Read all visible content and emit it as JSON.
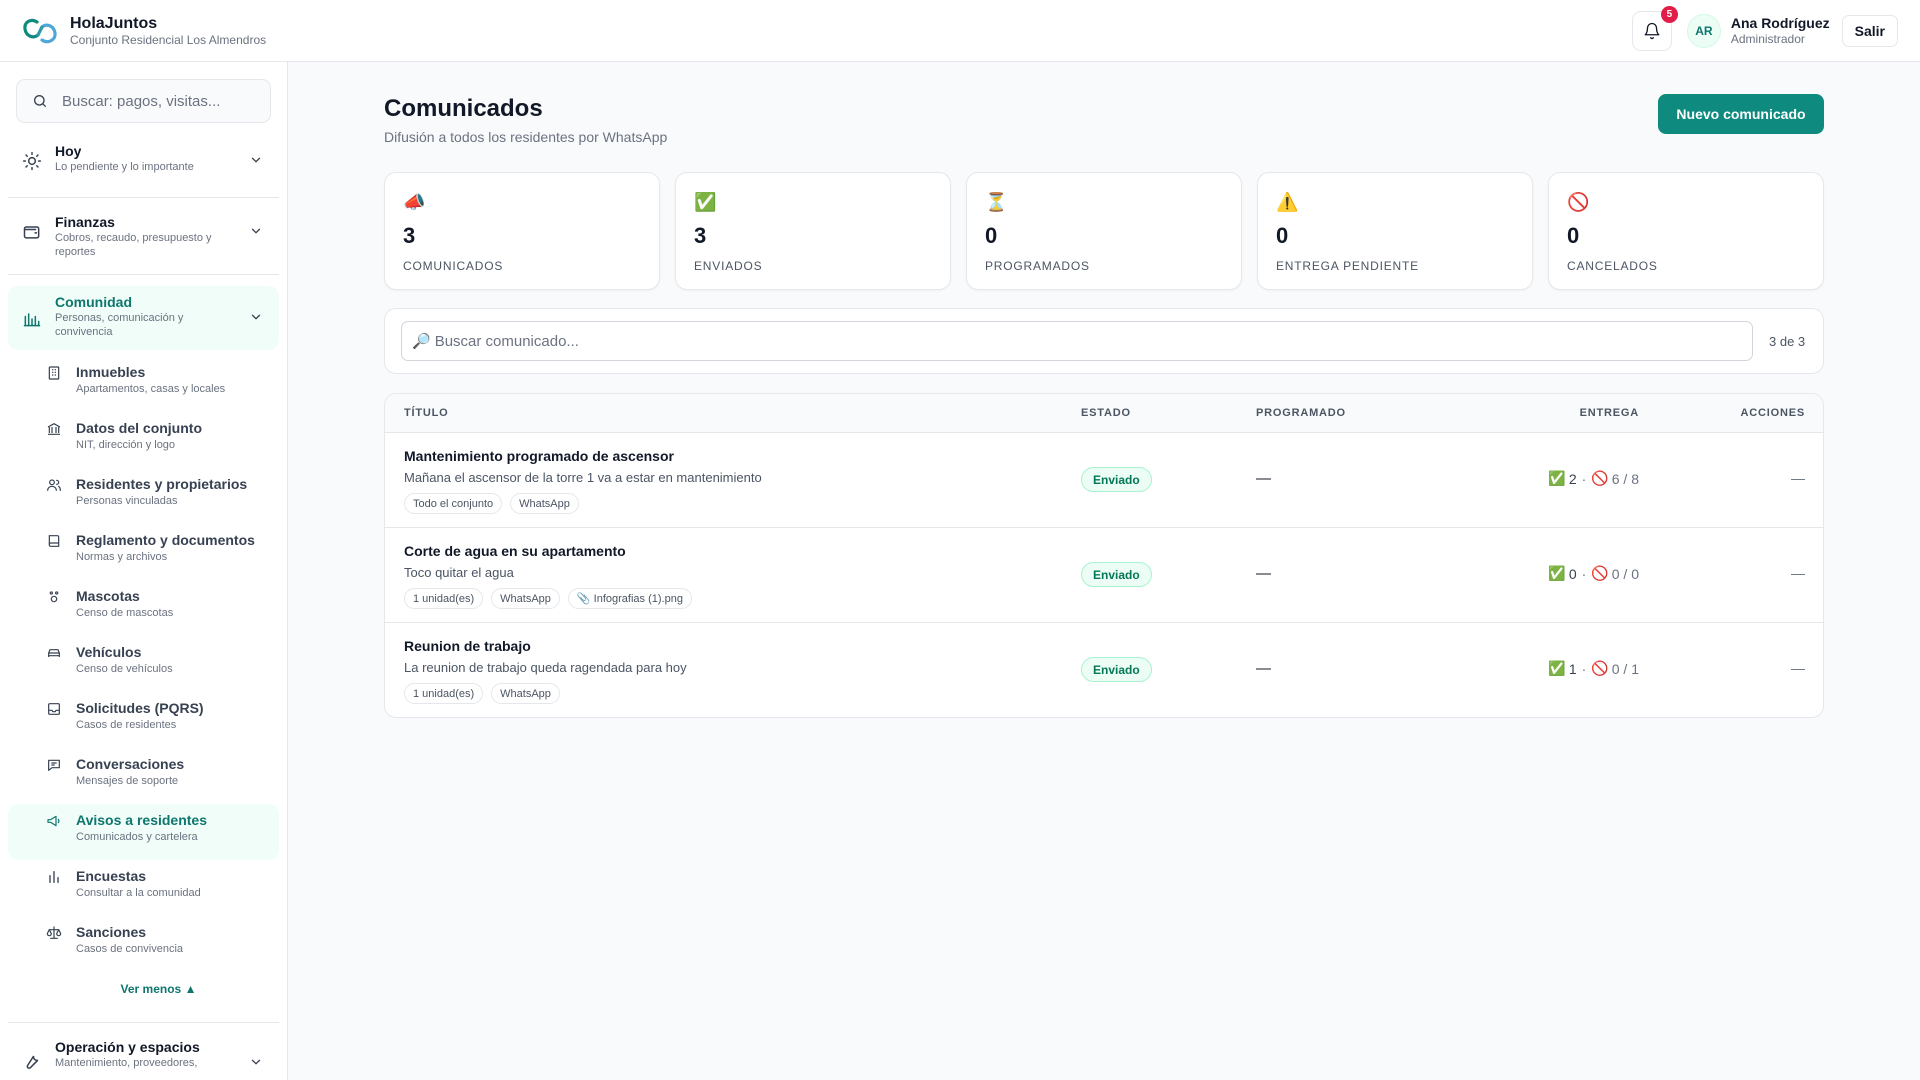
{
  "app": {
    "name": "HolaJuntos",
    "subtitle": "Conjunto Residencial Los Almendros"
  },
  "header": {
    "notifications_count": "5",
    "user_initials": "AR",
    "user_name": "Ana Rodríguez",
    "user_role": "Administrador",
    "logout_label": "Salir"
  },
  "sidebar": {
    "search_placeholder": "Buscar: pagos, visitas...",
    "groups": {
      "hoy": {
        "title": "Hoy",
        "subtitle": "Lo pendiente y lo importante"
      },
      "finanzas": {
        "title": "Finanzas",
        "subtitle": "Cobros, recaudo, presupuesto y reportes"
      },
      "comunidad": {
        "title": "Comunidad",
        "subtitle": "Personas, comunicación y convivencia"
      },
      "operacion": {
        "title": "Operación y espacios",
        "subtitle": "Mantenimiento, proveedores,"
      }
    },
    "items": [
      {
        "title": "Inmuebles",
        "subtitle": "Apartamentos, casas y locales",
        "icon": "building-icon"
      },
      {
        "title": "Datos del conjunto",
        "subtitle": "NIT, dirección y logo",
        "icon": "bank-icon"
      },
      {
        "title": "Residentes y propietarios",
        "subtitle": "Personas vinculadas",
        "icon": "users-icon"
      },
      {
        "title": "Reglamento y documentos",
        "subtitle": "Normas y archivos",
        "icon": "book-icon"
      },
      {
        "title": "Mascotas",
        "subtitle": "Censo de mascotas",
        "icon": "paw-icon"
      },
      {
        "title": "Vehículos",
        "subtitle": "Censo de vehículos",
        "icon": "car-icon"
      },
      {
        "title": "Solicitudes (PQRS)",
        "subtitle": "Casos de residentes",
        "icon": "inbox-icon"
      },
      {
        "title": "Conversaciones",
        "subtitle": "Mensajes de soporte",
        "icon": "chat-icon"
      },
      {
        "title": "Avisos a residentes",
        "subtitle": "Comunicados y cartelera",
        "icon": "megaphone-icon"
      },
      {
        "title": "Encuestas",
        "subtitle": "Consultar a la comunidad",
        "icon": "chart-icon"
      },
      {
        "title": "Sanciones",
        "subtitle": "Casos de convivencia",
        "icon": "scale-icon"
      }
    ],
    "ver_menos": "Ver menos ▲"
  },
  "page": {
    "title": "Comunicados",
    "subtitle": "Difusión a todos los residentes por WhatsApp",
    "new_button": "Nuevo comunicado"
  },
  "stats": [
    {
      "icon": "📣",
      "value": "3",
      "label": "COMUNICADOS"
    },
    {
      "icon": "✅",
      "value": "3",
      "label": "ENVIADOS"
    },
    {
      "icon": "⏳",
      "value": "0",
      "label": "PROGRAMADOS"
    },
    {
      "icon": "⚠️",
      "value": "0",
      "label": "ENTREGA PENDIENTE"
    },
    {
      "icon": "🚫",
      "value": "0",
      "label": "CANCELADOS"
    }
  ],
  "search": {
    "icon": "🔎",
    "placeholder": "Buscar comunicado...",
    "count": "3 de 3"
  },
  "table": {
    "headers": {
      "titulo": "TÍTULO",
      "estado": "ESTADO",
      "programado": "PROGRAMADO",
      "entrega": "ENTREGA",
      "acciones": "ACCIONES"
    },
    "rows": [
      {
        "title": "Mantenimiento programado de ascensor",
        "description": "Mañana el ascensor de la torre 1 va a estar en mantenimiento",
        "tags": [
          "Todo el conjunto",
          "WhatsApp"
        ],
        "status": "Enviado",
        "scheduled": "—",
        "delivered": "2",
        "failed_ratio": "6 / 8",
        "actions": "—"
      },
      {
        "title": "Corte de agua en su apartamento",
        "description": "Toco quitar el agua",
        "tags": [
          "1 unidad(es)",
          "WhatsApp",
          "📎 Infografias (1).png"
        ],
        "status": "Enviado",
        "scheduled": "—",
        "delivered": "0",
        "failed_ratio": "0 / 0",
        "actions": "—"
      },
      {
        "title": "Reunion de trabajo",
        "description": "La reunion de trabajo queda ragendada para hoy",
        "tags": [
          "1 unidad(es)",
          "WhatsApp"
        ],
        "status": "Enviado",
        "scheduled": "—",
        "delivered": "1",
        "failed_ratio": "0 / 1",
        "actions": "—"
      }
    ]
  },
  "colors": {
    "accent": "#0f8a7e",
    "accent_text": "#0f766e",
    "danger": "#e11d48",
    "active_bg": "#f0fdf9"
  }
}
